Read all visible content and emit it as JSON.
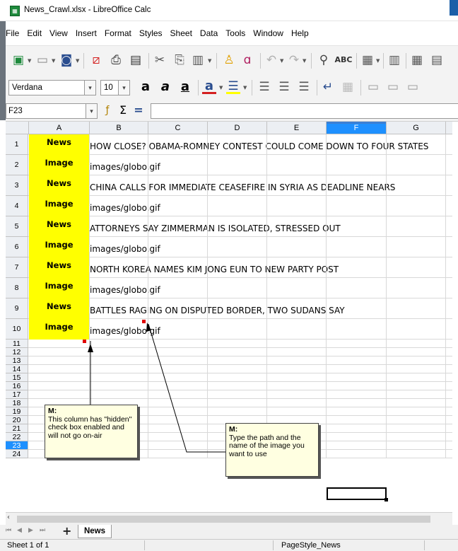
{
  "window": {
    "title": "News_Crawl.xlsx - LibreOffice Calc",
    "app_icon": "calc-icon"
  },
  "menu": [
    "File",
    "Edit",
    "View",
    "Insert",
    "Format",
    "Styles",
    "Sheet",
    "Data",
    "Tools",
    "Window",
    "Help"
  ],
  "toolbar": {
    "font_name": "Verdana",
    "font_size": "10",
    "icons": [
      "new-icon",
      "open-icon",
      "save-icon",
      "export-pdf-icon",
      "print-icon",
      "print-preview-icon",
      "cut-icon",
      "copy-icon",
      "paste-icon",
      "clone-formatting-icon",
      "clear-formatting-icon",
      "undo-icon",
      "redo-icon",
      "find-replace-icon",
      "spellcheck-icon",
      "row-icon",
      "bold-icon",
      "italic-icon",
      "underline-icon",
      "font-color-icon",
      "highlight-icon",
      "align-left-icon",
      "align-center-icon",
      "align-right-icon",
      "wrap-text-icon",
      "merge-cells-icon"
    ]
  },
  "formula_bar": {
    "cell_ref": "F23",
    "content": ""
  },
  "columns": [
    "A",
    "B",
    "C",
    "D",
    "E",
    "F",
    "G"
  ],
  "selected_column": "F",
  "rows": [
    "1",
    "2",
    "3",
    "4",
    "5",
    "6",
    "7",
    "8",
    "9",
    "10",
    "11",
    "12",
    "13",
    "14",
    "15",
    "16",
    "17",
    "18",
    "19",
    "20",
    "21",
    "22",
    "23",
    "24"
  ],
  "selected_row": "23",
  "cells": [
    {
      "a": "News",
      "b": "HOW CLOSE? OBAMA-ROMNEY CONTEST COULD COME DOWN TO FOUR STATES"
    },
    {
      "a": "Image",
      "b": "images/globo.gif"
    },
    {
      "a": "News",
      "b": "CHINA CALLS FOR IMMEDIATE CEASEFIRE IN SYRIA AS DEADLINE NEARS"
    },
    {
      "a": "Image",
      "b": "images/globo.gif"
    },
    {
      "a": "News",
      "b": "ATTORNEYS SAY ZIMMERMAN IS ISOLATED, STRESSED OUT"
    },
    {
      "a": "Image",
      "b": "images/globo.gif"
    },
    {
      "a": "News",
      "b": "NORTH KOREA NAMES KIM JONG EUN TO NEW PARTY POST"
    },
    {
      "a": "Image",
      "b": "images/globo.gif"
    },
    {
      "a": "News",
      "b": "BATTLES RAGING ON DISPUTED BORDER, TWO SUDANS SAY"
    },
    {
      "a": "Image",
      "b": "images/globo.gif"
    }
  ],
  "comments": [
    {
      "author": "M:",
      "text": "This column has \"hidden\" check box enabled and will not go on-air"
    },
    {
      "author": "M:",
      "text": "Type the path and the name of the image you want to use"
    }
  ],
  "sheet_tabs": [
    "News"
  ],
  "status": {
    "sheet": "Sheet 1 of 1",
    "page_style": "PageStyle_News"
  },
  "colors": {
    "highlight_yellow": "#ffff00",
    "selection_blue": "#1e90ff",
    "comment_bg": "#ffffe1"
  }
}
